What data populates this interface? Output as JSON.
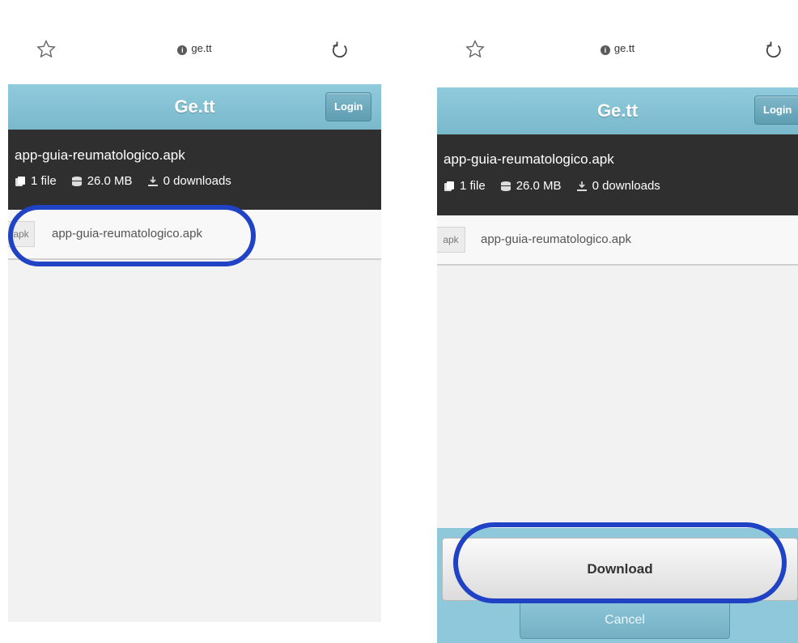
{
  "screens": [
    {
      "url": "ge.tt",
      "brand": "Ge.tt",
      "login_label": "Login",
      "file": {
        "name": "app-guia-reumatologico.apk",
        "files": "1 file",
        "size": "26.0 MB",
        "downloads": "0 downloads"
      },
      "row": {
        "ext": "apk",
        "name": "app-guia-reumatologico.apk"
      }
    },
    {
      "url": "ge.tt",
      "brand": "Ge.tt",
      "login_label": "Login",
      "file": {
        "name": "app-guia-reumatologico.apk",
        "files": "1 file",
        "size": "26.0 MB",
        "downloads": "0 downloads"
      },
      "row": {
        "ext": "apk",
        "name": "app-guia-reumatologico.apk"
      },
      "sheet": {
        "download_label": "Download",
        "cancel_label": "Cancel"
      }
    }
  ],
  "icons": {
    "star": "star-outline-icon",
    "reload": "reload-icon",
    "info": "info-icon",
    "file": "file-icon",
    "database": "database-icon",
    "download": "download-icon"
  },
  "colors": {
    "topbar": "#8fcbdc",
    "filebar": "#2f2f2f",
    "highlight": "#1f43c4",
    "sheet": "#8fc8da"
  }
}
